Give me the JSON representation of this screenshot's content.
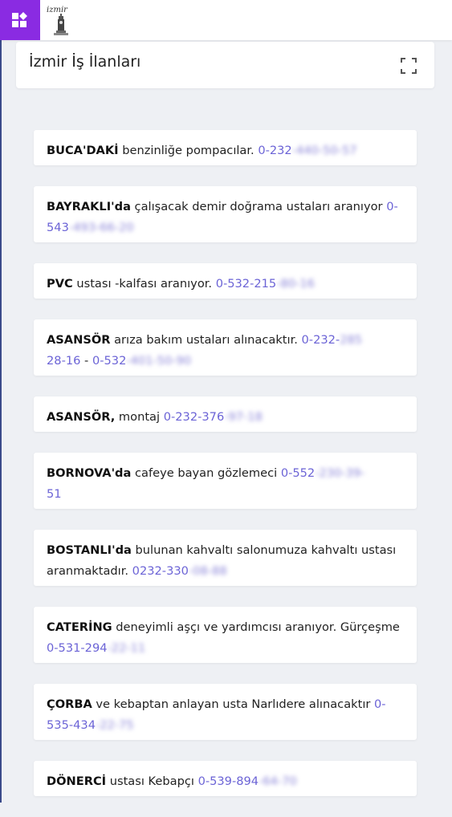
{
  "app": {
    "title": "İzmir İş İlanları"
  },
  "icons": {
    "app_button": "widgets-add-icon",
    "logo": "izmir-clock-tower-logo",
    "expand": "expand-fullscreen-icon"
  },
  "colors": {
    "accent": "#8a2be2",
    "phone": "#6b63d6",
    "background": "#eef0f4"
  },
  "listings": [
    {
      "bold": "BUCA'DAKİ",
      "text": " benzinliğe pompacılar. ",
      "phone_visible": "0-232",
      "phone_hidden": "-440-50-57"
    },
    {
      "bold": "BAYRAKLI'da",
      "text": " çalışacak demir doğrama ustaları aranıyor ",
      "phone_visible": "0-543",
      "phone_hidden": "-493-66-20"
    },
    {
      "bold": "PVC",
      "text": " ustası -kalfası aranıyor. ",
      "phone_visible": "0-532-215",
      "phone_hidden": "-80-16"
    },
    {
      "bold": "ASANSÖR",
      "text": " arıza bakım ustaları alınacaktır. ",
      "phone_visible": "0-232-",
      "phone_hidden": "285",
      "phone_visible2": "28-16",
      "sep": " - ",
      "phone_visible3": "0-532",
      "phone_hidden2": "-401-50-90"
    },
    {
      "bold": "ASANSÖR,",
      "text": " montaj ",
      "phone_visible": "0-232-376",
      "phone_hidden": "-97-18"
    },
    {
      "bold": "BORNOVA'da",
      "text": " cafeye bayan gözlemeci ",
      "phone_visible": "0-552",
      "phone_hidden": "-230-39-",
      "phone_visible2": "51"
    },
    {
      "bold": "BOSTANLI'da",
      "text": " bulunan kahvaltı salonumuza kahvaltı ustası aranmaktadır. ",
      "phone_visible": "0232-330",
      "phone_hidden": "-08-88"
    },
    {
      "bold": "CATERİNG",
      "text": " deneyimli aşçı ve yardımcısı aranıyor. Gürçeşme ",
      "phone_visible": "0-531-294",
      "phone_hidden": "-22-11"
    },
    {
      "bold": "ÇORBA",
      "text": " ve kebaptan anlayan usta Narlıdere alınacaktır ",
      "phone_visible": "0-535-434",
      "phone_hidden": "-22-75"
    },
    {
      "bold": "DÖNERCİ",
      "text": " ustası Kebapçı ",
      "phone_visible": "0-539-894",
      "phone_hidden": "-64-70"
    }
  ]
}
